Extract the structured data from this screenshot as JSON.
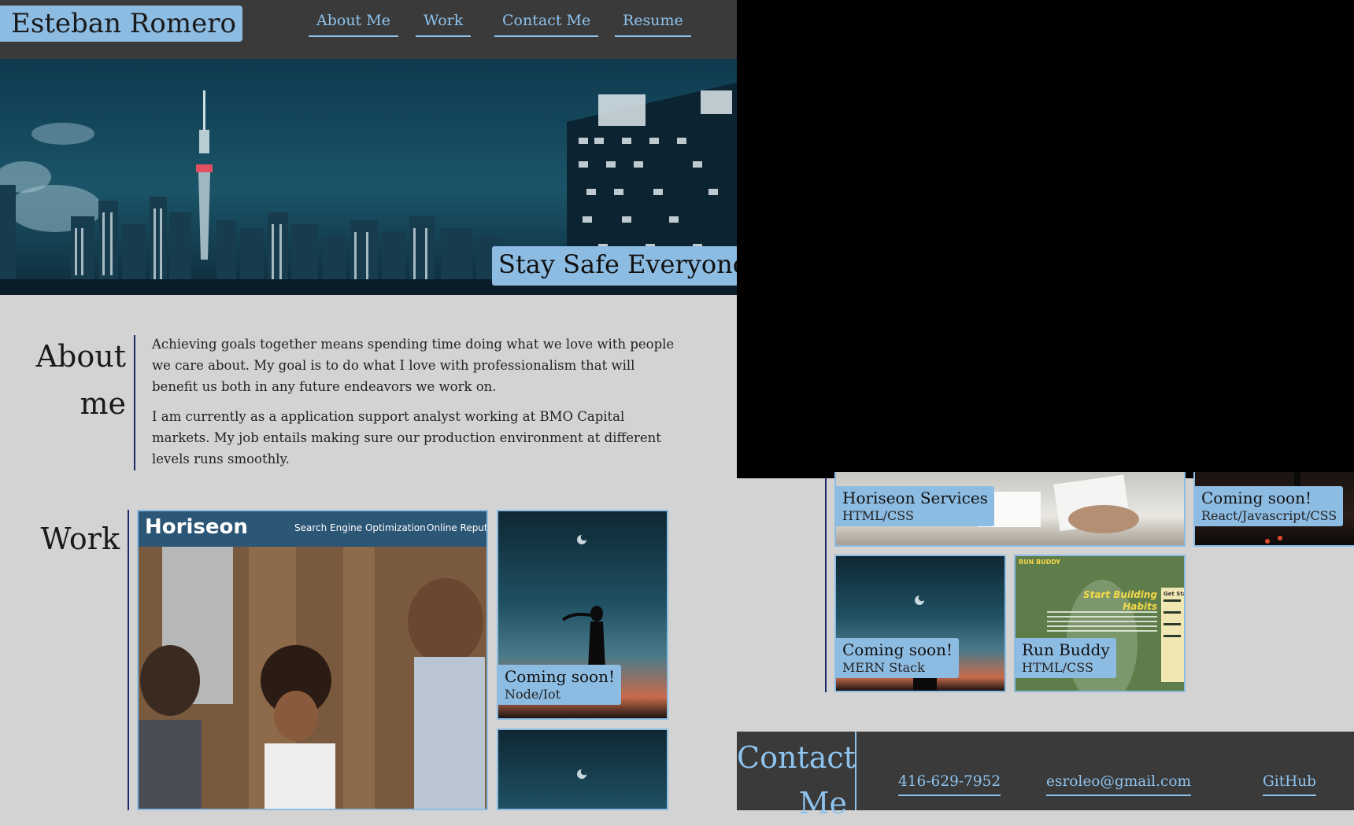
{
  "header": {
    "name": "Esteban Romero",
    "nav": [
      "About Me",
      "Work",
      "Contact Me",
      "Resume"
    ]
  },
  "hero": {
    "banner": "Stay Safe Everyone!"
  },
  "about": {
    "title_line1": "About",
    "title_line2": "me",
    "paragraphs": [
      "Achieving goals together means spending time doing what we love with people we care about. My goal is to do what I love with professionalism that will benefit us both in any future endeavors we work on.",
      "I am currently as a application support analyst working at BMO Capital markets. My job entails making sure our production environment at different levels runs smoothly."
    ]
  },
  "work": {
    "title": "Work",
    "left_cards": [
      {
        "title": "Coming soon!",
        "subtitle": "Node/Iot"
      }
    ],
    "horiseon_screenshot": {
      "logo": "Horiseon",
      "nav1": "Search Engine Optimization",
      "nav2": "Online Reputa"
    },
    "right_cards": [
      {
        "title": "Horiseon Services",
        "subtitle": "HTML/CSS"
      },
      {
        "title": "Coming soon!",
        "subtitle": "React/Javascript/CSS"
      },
      {
        "title": "Coming soon!",
        "subtitle": "MERN Stack"
      },
      {
        "title": "Run Buddy",
        "subtitle": "HTML/CSS"
      }
    ],
    "runbuddy_screenshot": {
      "brand": "RUN BUDDY",
      "headline_line1": "Start Building",
      "headline_line2": "Habits",
      "form_title": "Get Starte"
    }
  },
  "contact": {
    "title_line1": "Contact",
    "title_line2": "Me",
    "phone": "416-629-7952",
    "email": "esroleo@gmail.com",
    "github": "GitHub"
  },
  "colors": {
    "accent": "#8dbce3",
    "link": "#8ec3ee",
    "header_bg": "#3a3a3a",
    "page_bg": "#d3d3d3",
    "rule": "#1c2a6e"
  }
}
